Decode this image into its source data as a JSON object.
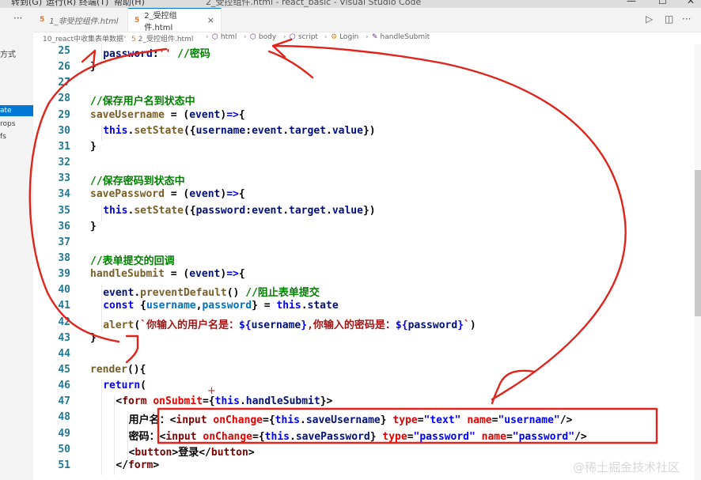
{
  "menu": {
    "items": [
      "转到(G)",
      "运行(R)",
      "终端(T)",
      "帮助(H)"
    ]
  },
  "window": {
    "title": "2_受控组件.html - react_basic - Visual Studio Code"
  },
  "sidebar": {
    "title": "方式",
    "more": "···",
    "items": [
      {
        "label": "ate",
        "active": true
      },
      {
        "label": "rops",
        "active": false
      },
      {
        "label": "fs",
        "active": false
      }
    ]
  },
  "tabs": [
    {
      "label": "1_非受控组件.html",
      "active": false,
      "icon": "html-file-icon"
    },
    {
      "label": "2_受控组件.html",
      "active": true,
      "icon": "html-file-icon",
      "close": "×"
    }
  ],
  "tab_actions": {
    "run": "▷",
    "split": "◫",
    "more": "···"
  },
  "breadcrumb": [
    {
      "label": "10_react中收集表单数据",
      "icon": ""
    },
    {
      "label": "2_受控组件.html",
      "icon": "html-file-icon"
    },
    {
      "label": "html",
      "icon": "element-icon"
    },
    {
      "label": "body",
      "icon": "element-icon"
    },
    {
      "label": "script",
      "icon": "element-icon"
    },
    {
      "label": "Login",
      "icon": "class-icon"
    },
    {
      "label": "handleSubmit",
      "icon": "method-icon"
    }
  ],
  "editor": {
    "lines": [
      {
        "num": "25",
        "indent": 2,
        "tokens": [
          [
            "v",
            "password"
          ],
          [
            "p",
            ":"
          ],
          [
            "s",
            "''"
          ],
          [
            "p",
            " "
          ],
          [
            "c",
            "//密码"
          ]
        ]
      },
      {
        "num": "26",
        "indent": 1,
        "tokens": [
          [
            "p",
            "}"
          ]
        ]
      },
      {
        "num": "27",
        "indent": 0,
        "tokens": []
      },
      {
        "num": "28",
        "indent": 1,
        "tokens": [
          [
            "c",
            "//保存用户名到状态中"
          ]
        ]
      },
      {
        "num": "29",
        "indent": 1,
        "tokens": [
          [
            "f",
            "saveUsername"
          ],
          [
            "p",
            " = ("
          ],
          [
            "v",
            "event"
          ],
          [
            "p",
            ")"
          ],
          [
            "k",
            "=>"
          ],
          [
            "p",
            "{"
          ]
        ]
      },
      {
        "num": "30",
        "indent": 2,
        "tokens": [
          [
            "k",
            "this"
          ],
          [
            "p",
            "."
          ],
          [
            "f",
            "setState"
          ],
          [
            "p",
            "({"
          ],
          [
            "v",
            "username"
          ],
          [
            "p",
            ":"
          ],
          [
            "v",
            "event"
          ],
          [
            "p",
            "."
          ],
          [
            "v",
            "target"
          ],
          [
            "p",
            "."
          ],
          [
            "v",
            "value"
          ],
          [
            "p",
            "})"
          ]
        ]
      },
      {
        "num": "31",
        "indent": 1,
        "tokens": [
          [
            "p",
            "}"
          ]
        ]
      },
      {
        "num": "32",
        "indent": 0,
        "tokens": []
      },
      {
        "num": "33",
        "indent": 1,
        "tokens": [
          [
            "c",
            "//保存密码到状态中"
          ]
        ]
      },
      {
        "num": "34",
        "indent": 1,
        "tokens": [
          [
            "f",
            "savePassword"
          ],
          [
            "p",
            " = ("
          ],
          [
            "v",
            "event"
          ],
          [
            "p",
            ")"
          ],
          [
            "k",
            "=>"
          ],
          [
            "p",
            "{"
          ]
        ]
      },
      {
        "num": "35",
        "indent": 2,
        "tokens": [
          [
            "k",
            "this"
          ],
          [
            "p",
            "."
          ],
          [
            "f",
            "setState"
          ],
          [
            "p",
            "({"
          ],
          [
            "v",
            "password"
          ],
          [
            "p",
            ":"
          ],
          [
            "v",
            "event"
          ],
          [
            "p",
            "."
          ],
          [
            "v",
            "target"
          ],
          [
            "p",
            "."
          ],
          [
            "v",
            "value"
          ],
          [
            "p",
            "})"
          ]
        ]
      },
      {
        "num": "36",
        "indent": 1,
        "tokens": [
          [
            "p",
            "}"
          ]
        ]
      },
      {
        "num": "37",
        "indent": 0,
        "tokens": []
      },
      {
        "num": "38",
        "indent": 1,
        "tokens": [
          [
            "c",
            "//表单提交的回调"
          ]
        ]
      },
      {
        "num": "39",
        "indent": 1,
        "tokens": [
          [
            "f",
            "handleSubmit"
          ],
          [
            "p",
            " = ("
          ],
          [
            "v",
            "event"
          ],
          [
            "p",
            ")"
          ],
          [
            "k",
            "=>"
          ],
          [
            "p",
            "{"
          ]
        ]
      },
      {
        "num": "40",
        "indent": 2,
        "tokens": [
          [
            "v",
            "event"
          ],
          [
            "p",
            "."
          ],
          [
            "f",
            "preventDefault"
          ],
          [
            "p",
            "() "
          ],
          [
            "c",
            "//阻止表单提交"
          ]
        ]
      },
      {
        "num": "41",
        "indent": 2,
        "tokens": [
          [
            "k",
            "const"
          ],
          [
            "p",
            " {"
          ],
          [
            "cl",
            "username"
          ],
          [
            "p",
            ","
          ],
          [
            "cl",
            "password"
          ],
          [
            "p",
            "} = "
          ],
          [
            "k",
            "this"
          ],
          [
            "p",
            "."
          ],
          [
            "v",
            "state"
          ]
        ]
      },
      {
        "num": "42",
        "indent": 2,
        "tokens": [
          [
            "f",
            "alert"
          ],
          [
            "p",
            "("
          ],
          [
            "s",
            "`你输入的用户名是："
          ],
          [
            "k",
            "${"
          ],
          [
            "v",
            "username"
          ],
          [
            "k",
            "}"
          ],
          [
            "s",
            ",你输入的密码是："
          ],
          [
            "k",
            "${"
          ],
          [
            "v",
            "password"
          ],
          [
            "k",
            "}"
          ],
          [
            "s",
            "`"
          ],
          [
            "p",
            ")"
          ]
        ]
      },
      {
        "num": "43",
        "indent": 1,
        "tokens": [
          [
            "p",
            "}"
          ]
        ]
      },
      {
        "num": "44",
        "indent": 0,
        "tokens": []
      },
      {
        "num": "45",
        "indent": 1,
        "tokens": [
          [
            "f",
            "render"
          ],
          [
            "p",
            "(){"
          ]
        ]
      },
      {
        "num": "46",
        "indent": 2,
        "tokens": [
          [
            "k",
            "return"
          ],
          [
            "p",
            "("
          ]
        ]
      },
      {
        "num": "47",
        "indent": 3,
        "tokens": [
          [
            "p",
            "<"
          ],
          [
            "t",
            "form"
          ],
          [
            "p",
            " "
          ],
          [
            "a",
            "onSubmit"
          ],
          [
            "p",
            "={"
          ],
          [
            "k",
            "this"
          ],
          [
            "p",
            "."
          ],
          [
            "v",
            "handleSubmit"
          ],
          [
            "p",
            "}>"
          ]
        ]
      },
      {
        "num": "48",
        "indent": 4,
        "tokens": [
          [
            "p",
            "用户名：<"
          ],
          [
            "t",
            "input"
          ],
          [
            "p",
            " "
          ],
          [
            "a",
            "onChange"
          ],
          [
            "p",
            "={"
          ],
          [
            "k",
            "this"
          ],
          [
            "p",
            "."
          ],
          [
            "v",
            "saveUsername"
          ],
          [
            "p",
            "} "
          ],
          [
            "a",
            "type"
          ],
          [
            "p",
            "="
          ],
          [
            "k",
            "\"text\""
          ],
          [
            "p",
            " "
          ],
          [
            "a",
            "name"
          ],
          [
            "p",
            "="
          ],
          [
            "k",
            "\"username\""
          ],
          [
            "p",
            "/>"
          ]
        ]
      },
      {
        "num": "49",
        "indent": 4,
        "tokens": [
          [
            "p",
            "密码：<"
          ],
          [
            "t",
            "input"
          ],
          [
            "p",
            " "
          ],
          [
            "a",
            "onChange"
          ],
          [
            "p",
            "={"
          ],
          [
            "k",
            "this"
          ],
          [
            "p",
            "."
          ],
          [
            "v",
            "savePassword"
          ],
          [
            "p",
            "} "
          ],
          [
            "a",
            "type"
          ],
          [
            "p",
            "="
          ],
          [
            "k",
            "\"password\""
          ],
          [
            "p",
            " "
          ],
          [
            "a",
            "name"
          ],
          [
            "p",
            "="
          ],
          [
            "k",
            "\"password\""
          ],
          [
            "p",
            "/>"
          ]
        ]
      },
      {
        "num": "50",
        "indent": 4,
        "tokens": [
          [
            "p",
            "<"
          ],
          [
            "t",
            "button"
          ],
          [
            "p",
            ">登录</"
          ],
          [
            "t",
            "button"
          ],
          [
            "p",
            ">"
          ]
        ]
      },
      {
        "num": "51",
        "indent": 3,
        "tokens": [
          [
            "p",
            "</"
          ],
          [
            "t",
            "form"
          ],
          [
            "p",
            ">"
          ]
        ]
      }
    ]
  },
  "watermark": "@稀土掘金技术社区",
  "annotation": {
    "color": "#e0241b",
    "plus": "+"
  }
}
